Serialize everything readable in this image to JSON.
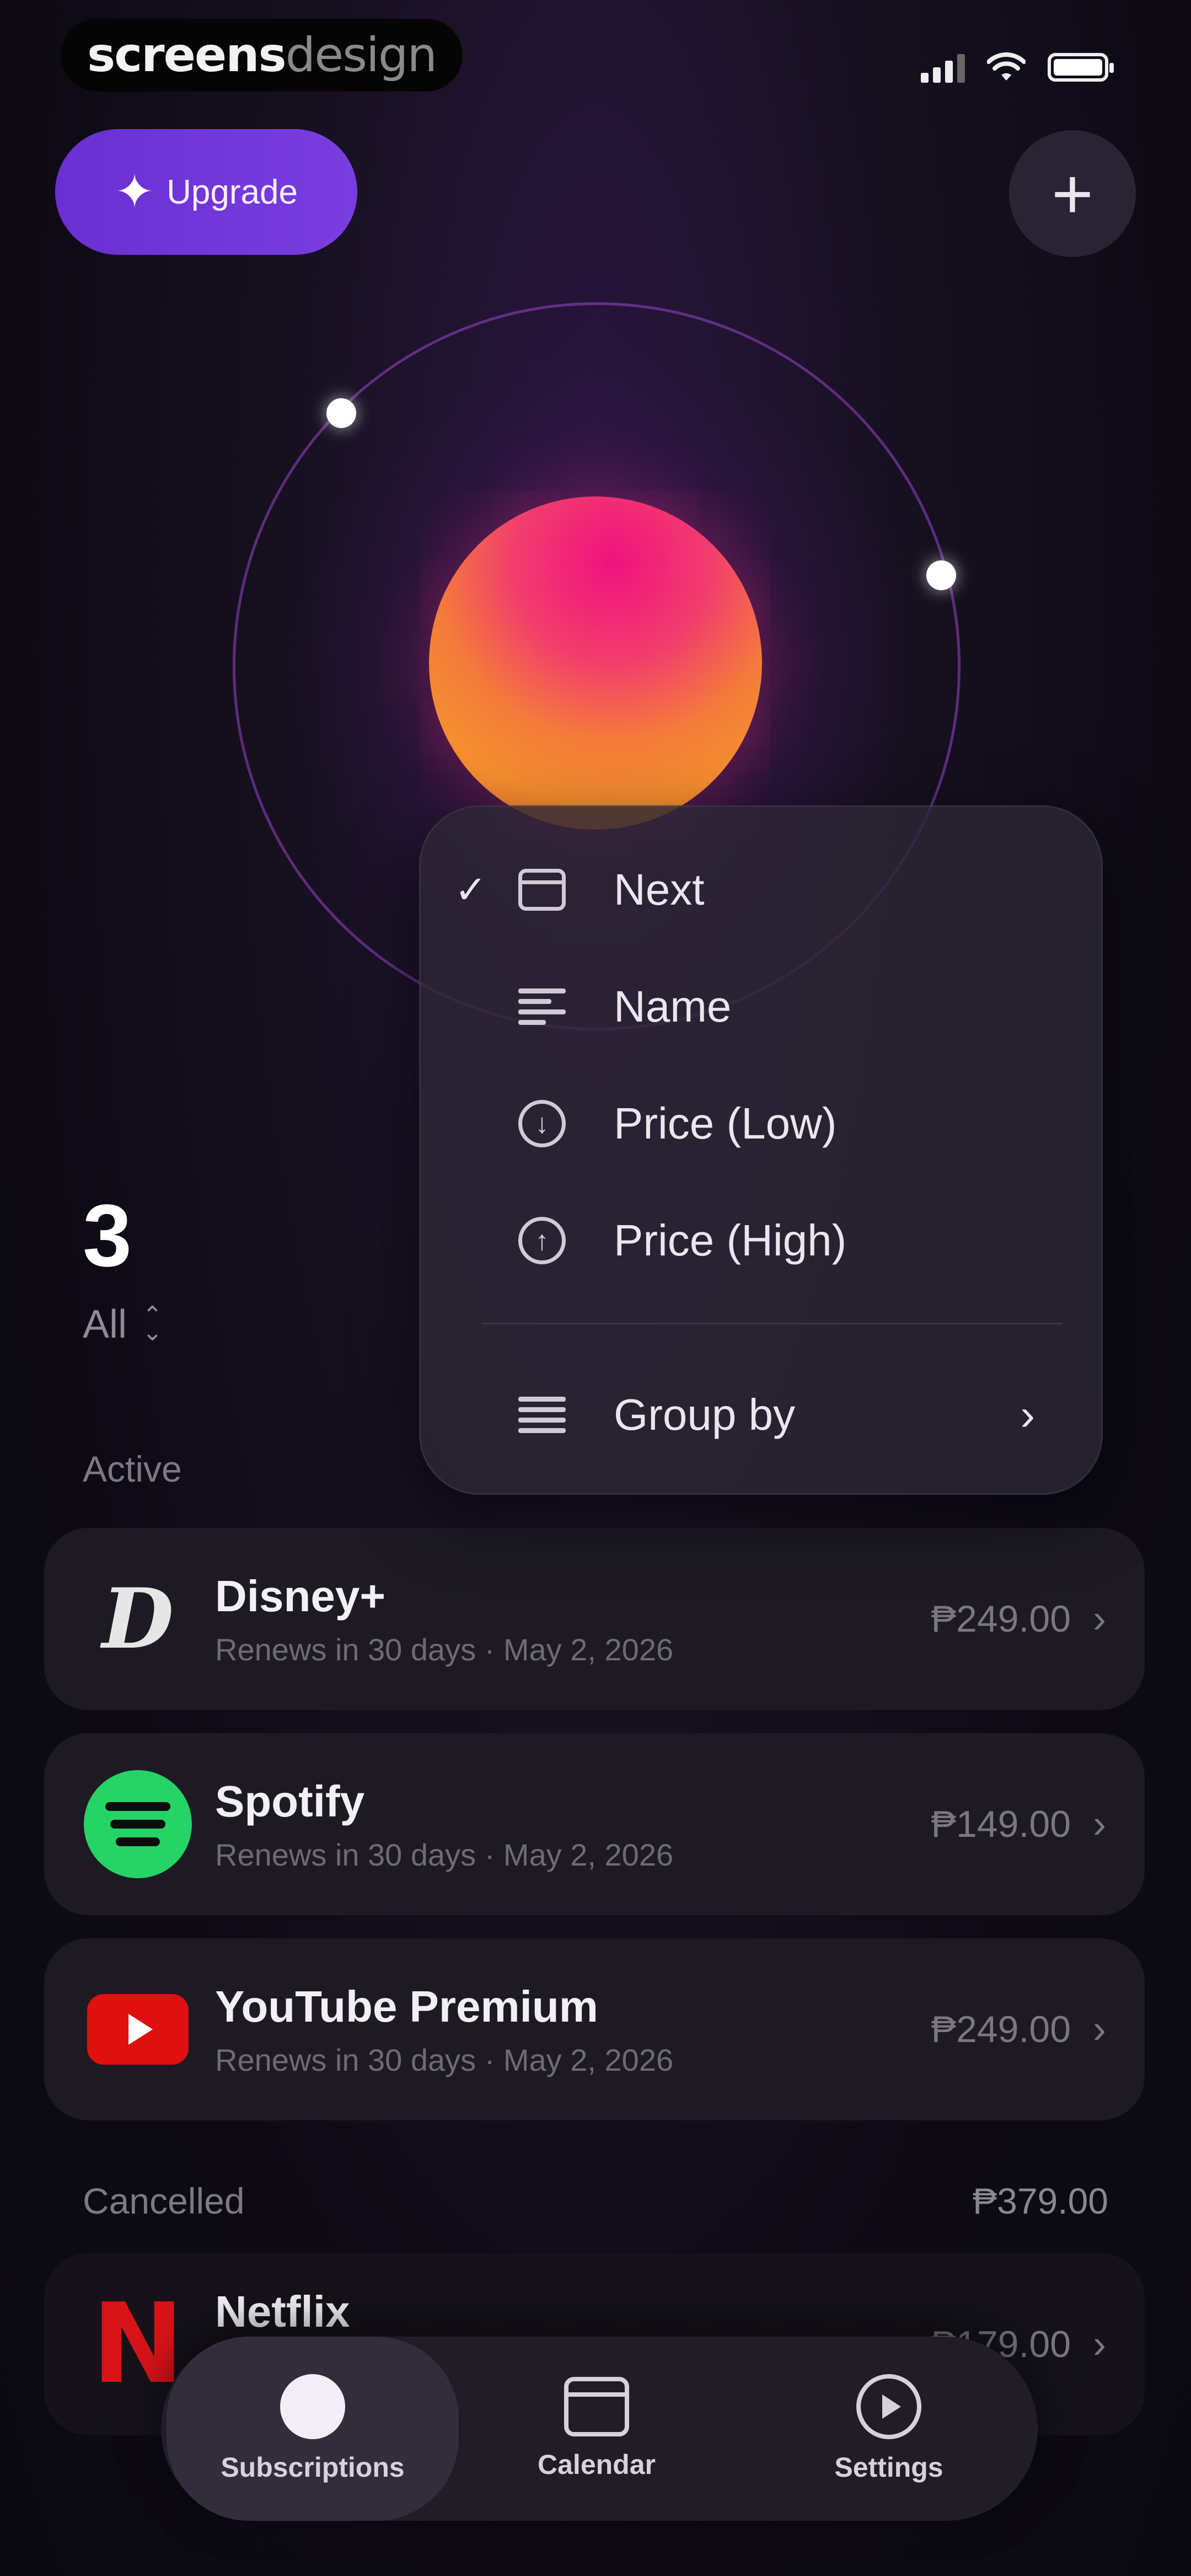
{
  "watermark": {
    "part1": "screens",
    "part2": "design"
  },
  "header": {
    "upgrade_label": "Upgrade",
    "add_label": "+"
  },
  "summary": {
    "count": "3",
    "filter_label": "All"
  },
  "sections": {
    "active": "Active",
    "cancelled": "Cancelled",
    "cancelled_total": "₱379.00"
  },
  "subscriptions_active": [
    {
      "name": "Disney+",
      "subtitle": "Renews in 30 days · May 2, 2026",
      "price": "₱249.00",
      "logo": "disney-icon"
    },
    {
      "name": "Spotify",
      "subtitle": "Renews in 30 days · May 2, 2026",
      "price": "₱149.00",
      "logo": "spotify-icon"
    },
    {
      "name": "YouTube Premium",
      "subtitle": "Renews in 30 days · May 2, 2026",
      "price": "₱249.00",
      "logo": "youtube-icon"
    }
  ],
  "subscriptions_cancelled": [
    {
      "name": "Netflix",
      "price": "₱179.00",
      "logo": "netflix-icon"
    }
  ],
  "sort_menu": {
    "selected": "Next",
    "items": [
      {
        "label": "Next",
        "icon": "calendar-icon",
        "checked": true
      },
      {
        "label": "Name",
        "icon": "align-left-icon",
        "checked": false
      },
      {
        "label": "Price (Low)",
        "icon": "arrow-down-circle-icon",
        "checked": false
      },
      {
        "label": "Price (High)",
        "icon": "arrow-up-circle-icon",
        "checked": false
      }
    ],
    "group_by": "Group by"
  },
  "nav": {
    "tabs": [
      {
        "label": "Subscriptions",
        "active": true
      },
      {
        "label": "Calendar",
        "active": false
      },
      {
        "label": "Settings",
        "active": false
      }
    ]
  },
  "colors": {
    "accent_purple": "#6a2fd1",
    "planet_pink": "#f0127f",
    "planet_orange": "#f58f2e",
    "spotify_green": "#25d366",
    "youtube_red": "#e01010",
    "netflix_red": "#d81418"
  }
}
